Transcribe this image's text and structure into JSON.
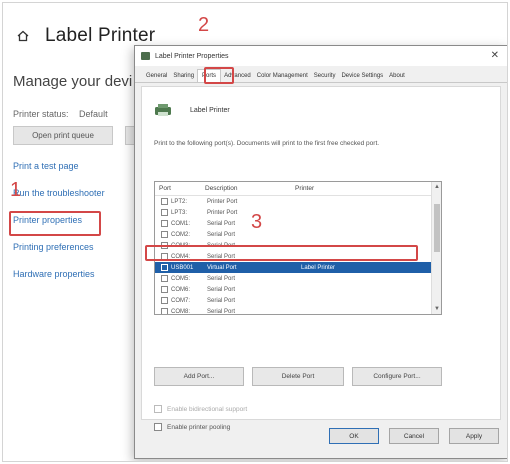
{
  "background_window": {
    "title": "Label Printer",
    "subtitle": "Manage your devi",
    "status_labels": [
      "Printer status:",
      "Default"
    ],
    "open_queue_button": "Open print queue",
    "links": [
      "Print a test page",
      "Run the troubleshooter",
      "Printer properties",
      "Printing preferences",
      "Hardware properties"
    ]
  },
  "dialog": {
    "title": "Label Printer Properties",
    "close_glyph": "✕",
    "tabs": [
      "General",
      "Sharing",
      "Ports",
      "Advanced",
      "Color Management",
      "Security",
      "Device Settings",
      "About"
    ],
    "active_tab_index": 2,
    "printer_name": "Label Printer",
    "description": "Print to the following port(s). Documents will print to the first free checked port.",
    "port_columns": [
      "Port",
      "Description",
      "Printer"
    ],
    "ports": [
      {
        "port": "LPT2:",
        "description": "Printer Port",
        "printer": "",
        "selected": false
      },
      {
        "port": "LPT3:",
        "description": "Printer Port",
        "printer": "",
        "selected": false
      },
      {
        "port": "COM1:",
        "description": "Serial Port",
        "printer": "",
        "selected": false
      },
      {
        "port": "COM2:",
        "description": "Serial Port",
        "printer": "",
        "selected": false
      },
      {
        "port": "COM3:",
        "description": "Serial Port",
        "printer": "",
        "selected": false
      },
      {
        "port": "COM4:",
        "description": "Serial Port",
        "printer": "",
        "selected": false
      },
      {
        "port": "USB001",
        "description": "Virtual Port",
        "printer": "Label Printer",
        "selected": true
      },
      {
        "port": "COM5:",
        "description": "Serial Port",
        "printer": "",
        "selected": false
      },
      {
        "port": "COM6:",
        "description": "Serial Port",
        "printer": "",
        "selected": false
      },
      {
        "port": "COM7:",
        "description": "Serial Port",
        "printer": "",
        "selected": false
      },
      {
        "port": "COM8:",
        "description": "Serial Port",
        "printer": "",
        "selected": false
      }
    ],
    "add_port_button": "Add Port...",
    "delete_port_button": "Delete Port",
    "configure_port_button": "Configure Port...",
    "bidirectional_label": "Enable bidirectional support",
    "pooling_label": "Enable printer pooling",
    "ok_button": "OK",
    "cancel_button": "Cancel",
    "apply_button": "Apply"
  },
  "annotations": {
    "step1": "1",
    "step2": "2",
    "step3": "3",
    "color": "#d34747"
  }
}
